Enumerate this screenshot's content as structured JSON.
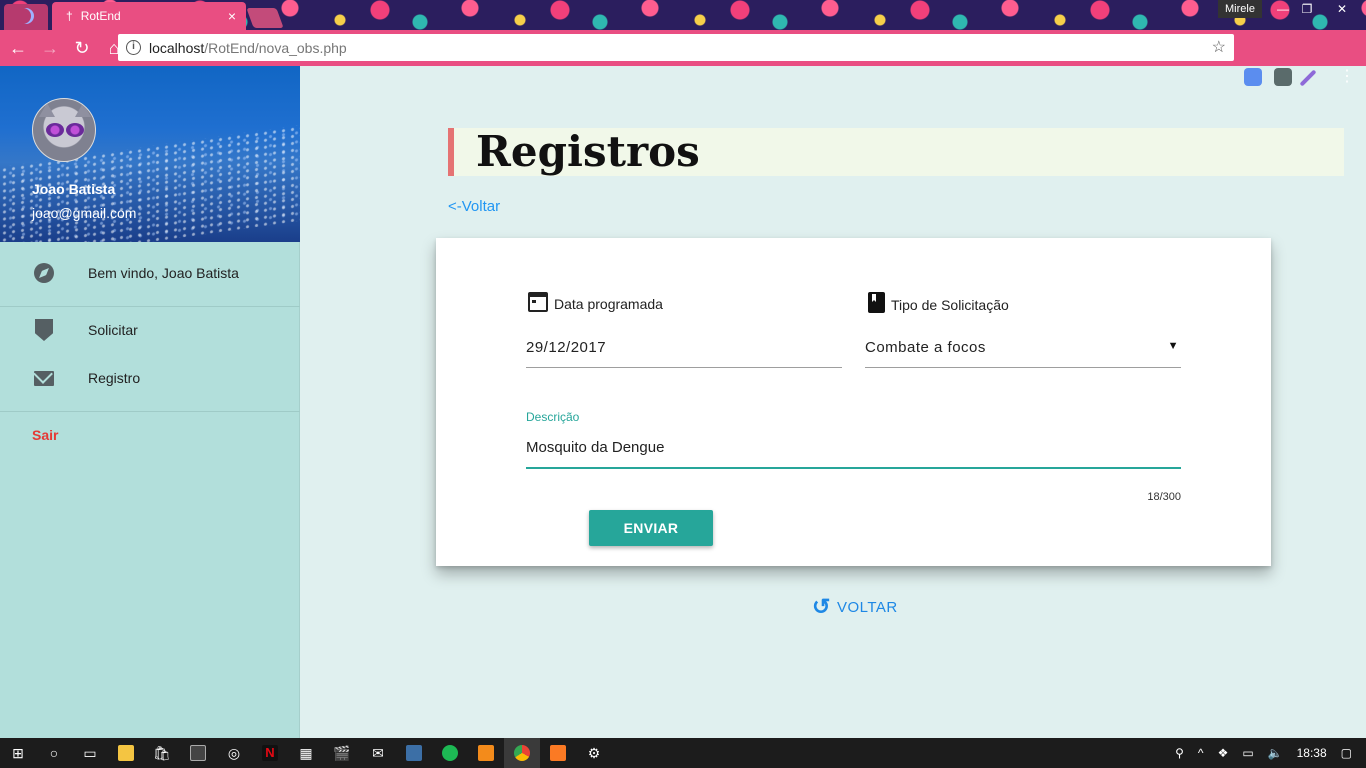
{
  "browser": {
    "tab_title": "RotEnd",
    "tab_close": "×",
    "url_host": "localhost",
    "url_path": "/RotEnd/nova_obs.php",
    "window_user": "Mirele",
    "min": "—",
    "max": "❐",
    "close": "✕",
    "accent": "#e94e82"
  },
  "sidebar": {
    "user_name": "Joao Batista",
    "user_email": "joao@gmail.com",
    "items": [
      {
        "label": "Bem vindo, Joao Batista",
        "icon": "compass-icon"
      },
      {
        "label": "Solicitar",
        "icon": "shield-check-icon"
      },
      {
        "label": "Registro",
        "icon": "mail-icon"
      }
    ],
    "logout": "Sair"
  },
  "main": {
    "title": "Registros",
    "back_link": "<-Voltar",
    "form": {
      "date_label": "Data programada",
      "date_value": "29/12/2017",
      "type_label": "Tipo de Solicitação",
      "type_value": "Combate a focos",
      "desc_label": "Descrição",
      "desc_value": "Mosquito da Dengue",
      "counter": "18/300",
      "submit": "ENVIAR"
    },
    "bottom_back": "VOLTAR"
  },
  "taskbar": {
    "time": "18:38"
  }
}
